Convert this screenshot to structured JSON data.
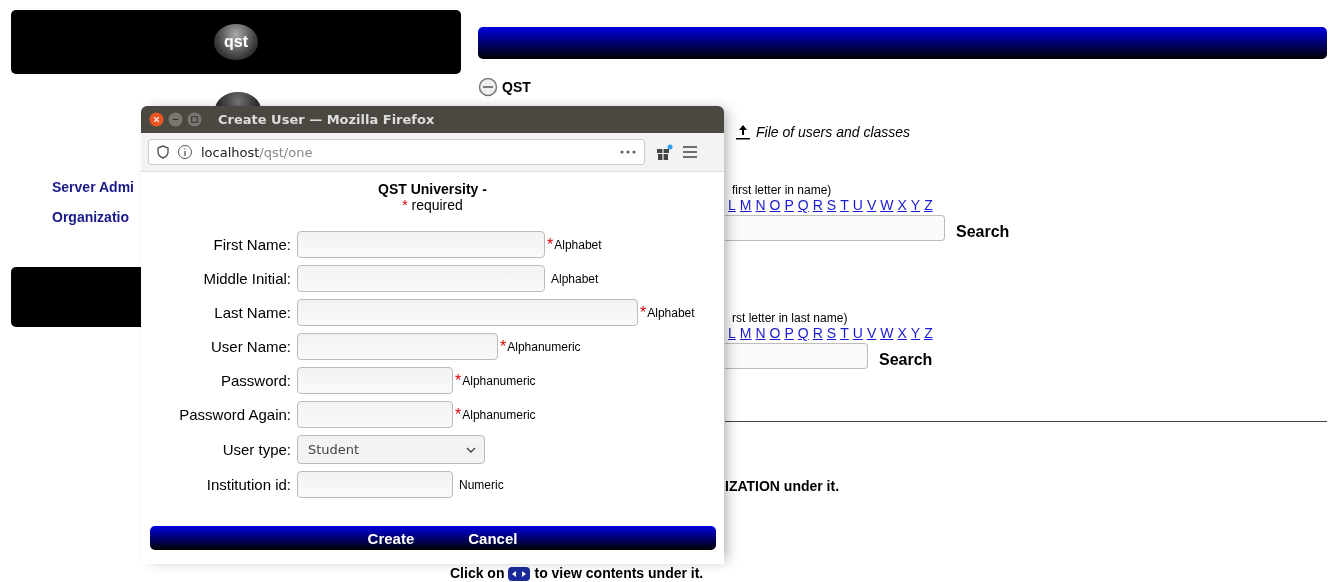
{
  "page": {
    "logo": "qst",
    "sidebar_links": [
      "Server Admi",
      "Organizatio"
    ],
    "tree_root": {
      "label": "QST",
      "expanded": true
    },
    "upload_link": "File of users and classes",
    "searches": [
      {
        "hint": "first letter in name)",
        "letters": [
          "L",
          "M",
          "N",
          "O",
          "P",
          "Q",
          "R",
          "S",
          "T",
          "U",
          "V",
          "W",
          "X",
          "Y",
          "Z"
        ],
        "button": "Search"
      },
      {
        "hint": "rst letter in last name)",
        "letters": [
          "L",
          "M",
          "N",
          "O",
          "P",
          "Q",
          "R",
          "S",
          "T",
          "U",
          "V",
          "W",
          "X",
          "Y",
          "Z"
        ],
        "button": "Search"
      }
    ],
    "notes": [
      "IZATION under it."
    ],
    "click_note": {
      "before": "Click on",
      "after": "to view contents under it."
    }
  },
  "popup": {
    "title": "Create User — Mozilla Firefox",
    "url_host": "localhost",
    "url_path": "/qst/one",
    "heading": "QST University -",
    "required_legend": {
      "mark": "*",
      "text": "required"
    },
    "fields": [
      {
        "label": "First Name:",
        "kind": "text",
        "mark": "*",
        "hint": "Alphabet"
      },
      {
        "label": "Middle Initial:",
        "kind": "text",
        "hint": "Alphabet"
      },
      {
        "label": "Last Name:",
        "kind": "text",
        "mark": "*",
        "hint": "Alphabet"
      },
      {
        "label": "User Name:",
        "kind": "text",
        "mark": "*",
        "hint": "Alphanumeric"
      },
      {
        "label": "Password:",
        "kind": "text",
        "mark": "*",
        "hint": "Alphanumeric"
      },
      {
        "label": "Password Again:",
        "kind": "text",
        "mark": "*",
        "hint": "Alphanumeric"
      },
      {
        "label": "User type:",
        "kind": "select",
        "value": "Student"
      },
      {
        "label": "Institution id:",
        "kind": "text",
        "hint": "Numeric"
      }
    ],
    "buttons": [
      "Create",
      "Cancel"
    ]
  }
}
